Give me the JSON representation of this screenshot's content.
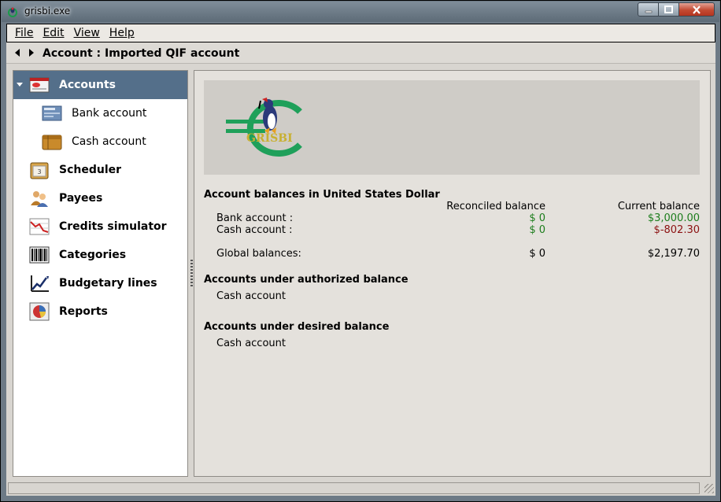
{
  "window": {
    "title": "grisbi.exe"
  },
  "menu": [
    {
      "label": "File"
    },
    {
      "label": "Edit"
    },
    {
      "label": "View"
    },
    {
      "label": "Help"
    }
  ],
  "heading": {
    "title": "Account : Imported QIF account"
  },
  "sidebar": {
    "items": [
      {
        "label": "Accounts",
        "icon": "accounts-icon",
        "selected": true
      },
      {
        "label": "Bank account",
        "icon": "bank-card-icon"
      },
      {
        "label": "Cash account",
        "icon": "wallet-icon"
      },
      {
        "label": "Scheduler",
        "icon": "calendar-icon"
      },
      {
        "label": "Payees",
        "icon": "people-icon"
      },
      {
        "label": "Credits simulator",
        "icon": "chart-decline-icon"
      },
      {
        "label": "Categories",
        "icon": "barcode-icon"
      },
      {
        "label": "Budgetary lines",
        "icon": "chart-rising-icon"
      },
      {
        "label": "Reports",
        "icon": "pie-chart-icon"
      }
    ]
  },
  "logo": {
    "text": "GRISBI"
  },
  "summary": {
    "balances_title": "Account balances in United States Dollar",
    "col_reconciled": "Reconciled balance",
    "col_current": "Current balance",
    "rows": [
      {
        "name": "Bank account :",
        "reconciled": "$ 0",
        "current": "$3,000.00"
      },
      {
        "name": "Cash account :",
        "reconciled": "$ 0",
        "current": "$-802.30"
      }
    ],
    "global": {
      "name": "Global balances:",
      "reconciled": "$ 0",
      "current": "$2,197.70"
    },
    "authorized_title": "Accounts under authorized balance",
    "authorized_items": [
      "Cash account"
    ],
    "desired_title": "Accounts under desired balance",
    "desired_items": [
      "Cash account"
    ]
  },
  "colors": {
    "positive": "#1c7d1c",
    "negative": "#8b1010",
    "selection": "#546f8a"
  }
}
